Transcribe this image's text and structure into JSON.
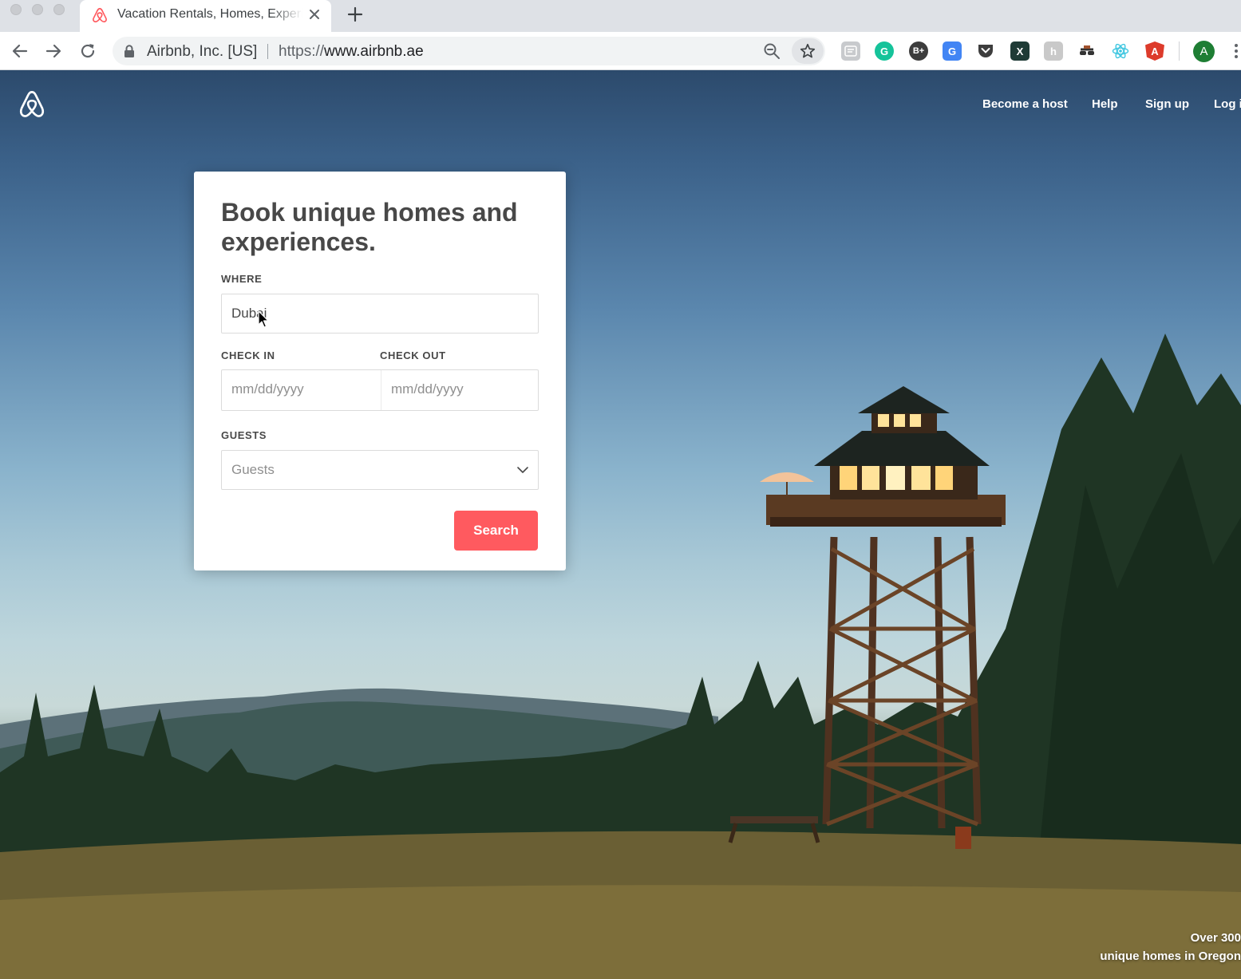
{
  "browser": {
    "tab": {
      "title": "Vacation Rentals, Homes, Experiences & Places",
      "favicon": "airbnb-logo-icon"
    },
    "toolbar": {
      "site_identity": "Airbnb, Inc. [US]",
      "url_scheme": "https://",
      "url_host": "www.airbnb.ae"
    },
    "extensions": [
      {
        "name": "extension-reader-icon"
      },
      {
        "name": "extension-grammarly-icon",
        "text": "G"
      },
      {
        "name": "extension-bplus-icon",
        "text": "B+"
      },
      {
        "name": "extension-translate-icon",
        "text": "G"
      },
      {
        "name": "extension-pocket-icon"
      },
      {
        "name": "extension-excel-icon",
        "text": "X"
      },
      {
        "name": "extension-h-icon",
        "text": "h"
      },
      {
        "name": "extension-incognito-icon"
      },
      {
        "name": "extension-react-icon"
      },
      {
        "name": "extension-angular-icon",
        "text": "A"
      }
    ],
    "profile_initial": "A"
  },
  "page": {
    "nav": {
      "become_host": "Become a host",
      "help": "Help",
      "sign_up": "Sign up",
      "log_in": "Log i"
    },
    "search_card": {
      "heading": "Book unique homes and experiences.",
      "where_label": "WHERE",
      "where_value": "Dubai",
      "check_in_label": "CHECK IN",
      "check_in_placeholder": "mm/dd/yyyy",
      "check_out_label": "CHECK OUT",
      "check_out_placeholder": "mm/dd/yyyy",
      "guests_label": "GUESTS",
      "guests_placeholder": "Guests",
      "search_button": "Search"
    },
    "hero_caption": {
      "line1": "Over 300",
      "line2": "unique homes in Oregon"
    }
  },
  "colors": {
    "brand": "#ff5a5f",
    "heading_text": "#484848"
  }
}
